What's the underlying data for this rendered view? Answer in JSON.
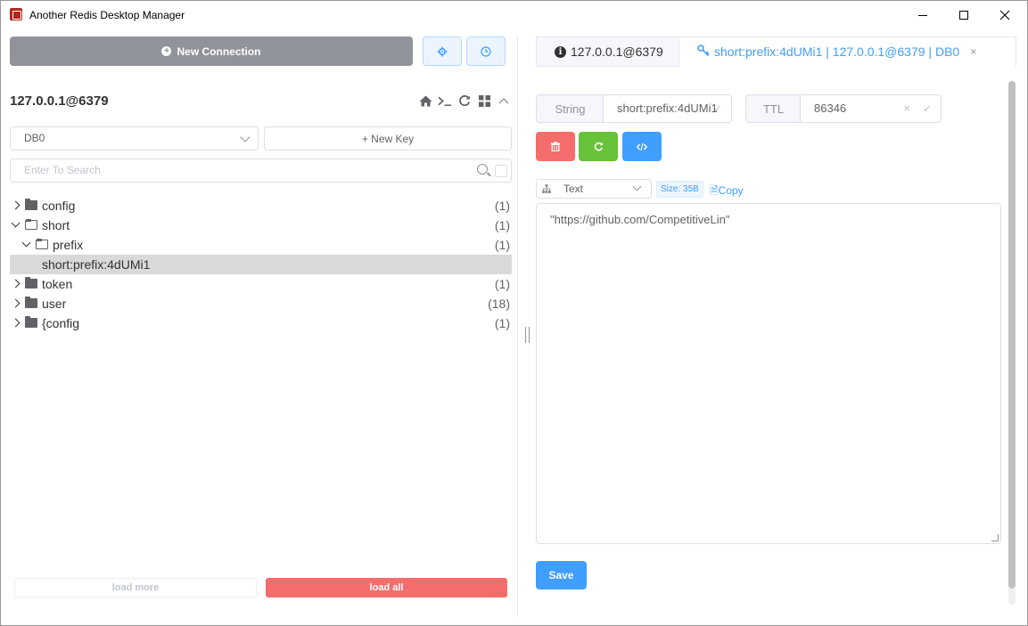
{
  "window": {
    "title": "Another Redis Desktop Manager"
  },
  "left": {
    "new_connection_label": "New Connection",
    "connection_title": "127.0.0.1@6379",
    "db_select_value": "DB0",
    "new_key_label": "+ New Key",
    "search_placeholder": "Enter To Search",
    "tree": [
      {
        "label": "config",
        "count": "(1)",
        "level": 0,
        "expanded": false,
        "type": "folder"
      },
      {
        "label": "short",
        "count": "(1)",
        "level": 0,
        "expanded": true,
        "type": "folder"
      },
      {
        "label": "prefix",
        "count": "(1)",
        "level": 1,
        "expanded": true,
        "type": "folder"
      },
      {
        "label": "short:prefix:4dUMi1",
        "count": "",
        "level": 2,
        "type": "key",
        "selected": true
      },
      {
        "label": "token",
        "count": "(1)",
        "level": 0,
        "expanded": false,
        "type": "folder"
      },
      {
        "label": "user",
        "count": "(18)",
        "level": 0,
        "expanded": false,
        "type": "folder"
      },
      {
        "label": "{config",
        "count": "(1)",
        "level": 0,
        "expanded": false,
        "type": "folder"
      }
    ],
    "load_more_label": "load more",
    "load_all_label": "load all"
  },
  "right": {
    "tabs": [
      {
        "label": "127.0.0.1@6379",
        "icon": "info-icon",
        "active": false
      },
      {
        "label": "short:prefix:4dUMi1 | 127.0.0.1@6379 | DB0",
        "icon": "key-icon",
        "active": true,
        "close": "×"
      }
    ],
    "key_type": "String",
    "key_name": "short:prefix:4dUMi1",
    "ttl_label": "TTL",
    "ttl_value": "86346",
    "format_value": "Text",
    "size_tag": "Size: 35B",
    "copy_label": "Copy",
    "value_text": "\"https://github.com/CompetitiveLin\"",
    "save_label": "Save"
  },
  "colors": {
    "primary": "#409eff",
    "danger": "#f56c6c",
    "success": "#67c23a",
    "info": "#909399"
  }
}
